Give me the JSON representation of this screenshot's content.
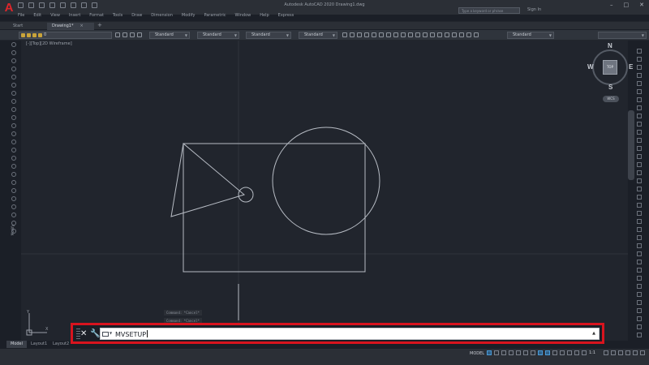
{
  "app": {
    "title": "Autodesk AutoCAD 2020  Drawing1.dwg",
    "search_placeholder": "Type a keyword or phrase",
    "sign_in": "Sign In",
    "window_controls": [
      "–",
      "□",
      "✕"
    ]
  },
  "menu": [
    "File",
    "Edit",
    "View",
    "Insert",
    "Format",
    "Tools",
    "Draw",
    "Dimension",
    "Modify",
    "Parametric",
    "Window",
    "Help",
    "Express"
  ],
  "doc_tabs": {
    "start": "Start",
    "active": "Drawing1*",
    "close": "×",
    "add": "+"
  },
  "properties": {
    "layer": "0",
    "styles": [
      "Standard",
      "Standard",
      "Standard",
      "Standard",
      "Standard"
    ]
  },
  "viewport_label": "[-][Top][2D Wireframe]",
  "viewcube": {
    "face": "TOP",
    "north": "N",
    "south": "S",
    "east": "E",
    "west": "W",
    "wcs": "WCS"
  },
  "ucs": {
    "y": "Y",
    "x": "X"
  },
  "left_palette_label": "Modify",
  "command_history": [
    "Command: *Cancel*",
    "Command: *Cancel*"
  ],
  "command_line": {
    "close_icon": "close-icon",
    "customize_icon": "wrench-icon",
    "input_value": "MVSETUP",
    "dropdown": "▲"
  },
  "layout_tabs": [
    "Model",
    "Layout1",
    "Layout2"
  ],
  "status": {
    "model": "MODEL",
    "scale": "1:1"
  },
  "colors": {
    "canvas": "#21252d",
    "highlight": "#d8141e",
    "brand": "#e0262b"
  }
}
